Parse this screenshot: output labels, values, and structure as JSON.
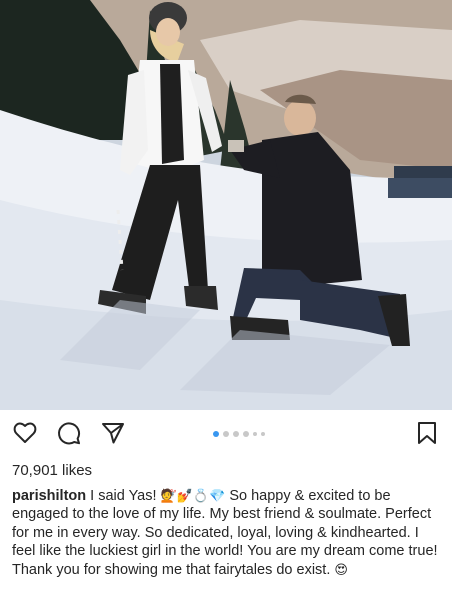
{
  "post": {
    "likes_text": "70,901 likes",
    "username": "parishilton",
    "caption_part1": " I said Yas! ",
    "caption_emojis": "💇💅💍💎",
    "caption_part2": " So happy & excited to be engaged to the love of my life. My best friend & soulmate. Perfect for me in every way. So dedicated, loyal, loving & kindhearted. I feel like the luckiest girl in the world! You are my dream come true! Thank you for showing me that fairytales do exist.",
    "caption_end_emoji": "😍"
  },
  "actions": {
    "icons": [
      "heart-icon",
      "comment-icon",
      "share-icon",
      "bookmark-icon"
    ]
  },
  "carousel": {
    "total": 6,
    "active_index": 0
  },
  "colors": {
    "accent": "#3897f0",
    "text": "#262626"
  }
}
